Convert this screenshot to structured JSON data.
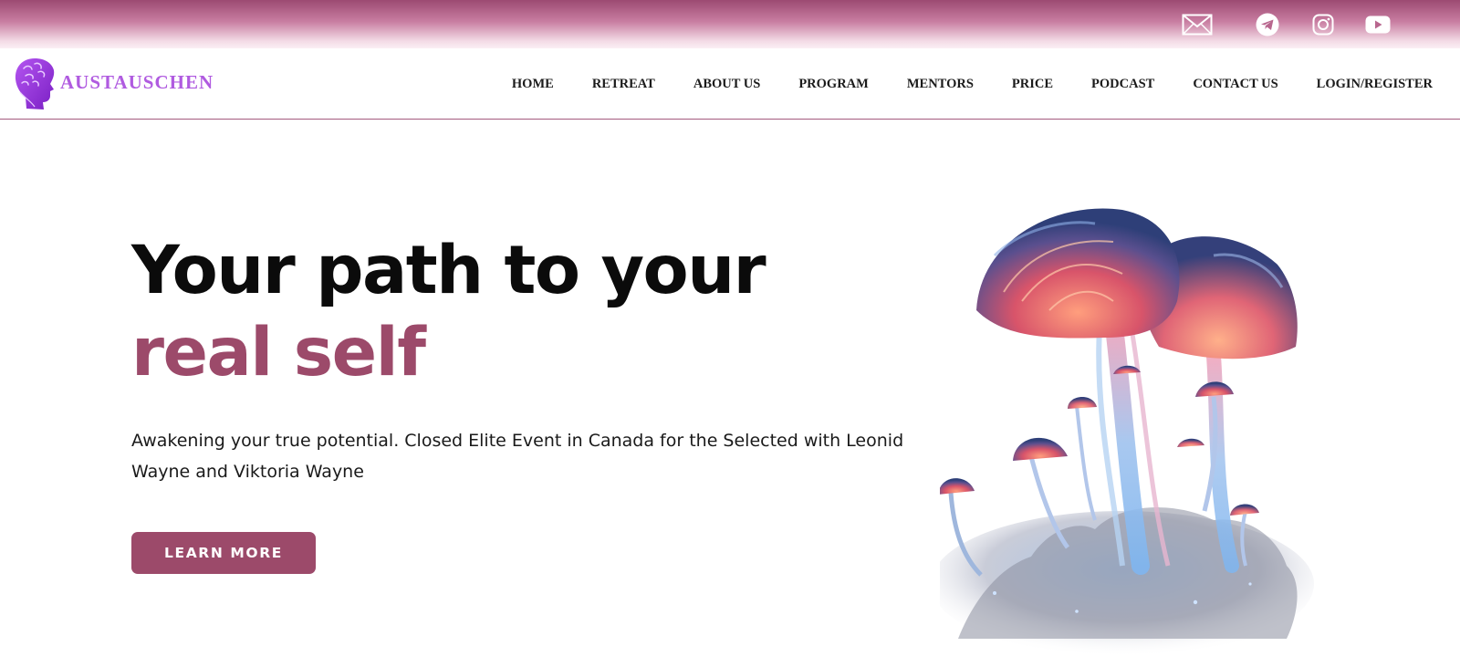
{
  "brand": {
    "name": "AUSTAUSCHEN"
  },
  "social": {
    "icons": [
      "envelope-icon",
      "telegram-icon",
      "instagram-icon",
      "youtube-icon"
    ]
  },
  "nav": {
    "items": [
      "HOME",
      "RETREAT",
      "ABOUT US",
      "PROGRAM",
      "MENTORS",
      "PRICE",
      "PODCAST",
      "CONTACT US",
      "LOGIN/REGISTER"
    ]
  },
  "hero": {
    "title_line1": "Your path to your",
    "title_line2": "real self",
    "subtitle": "Awakening your true potential. Closed Elite Event in Canada for the Selected with Leonid Wayne and Viktoria Wayne",
    "cta_label": "LEARN MORE"
  },
  "colors": {
    "accent": "#9c4a6a",
    "logo": "#b05be0",
    "topbar": "#9c4a72"
  }
}
